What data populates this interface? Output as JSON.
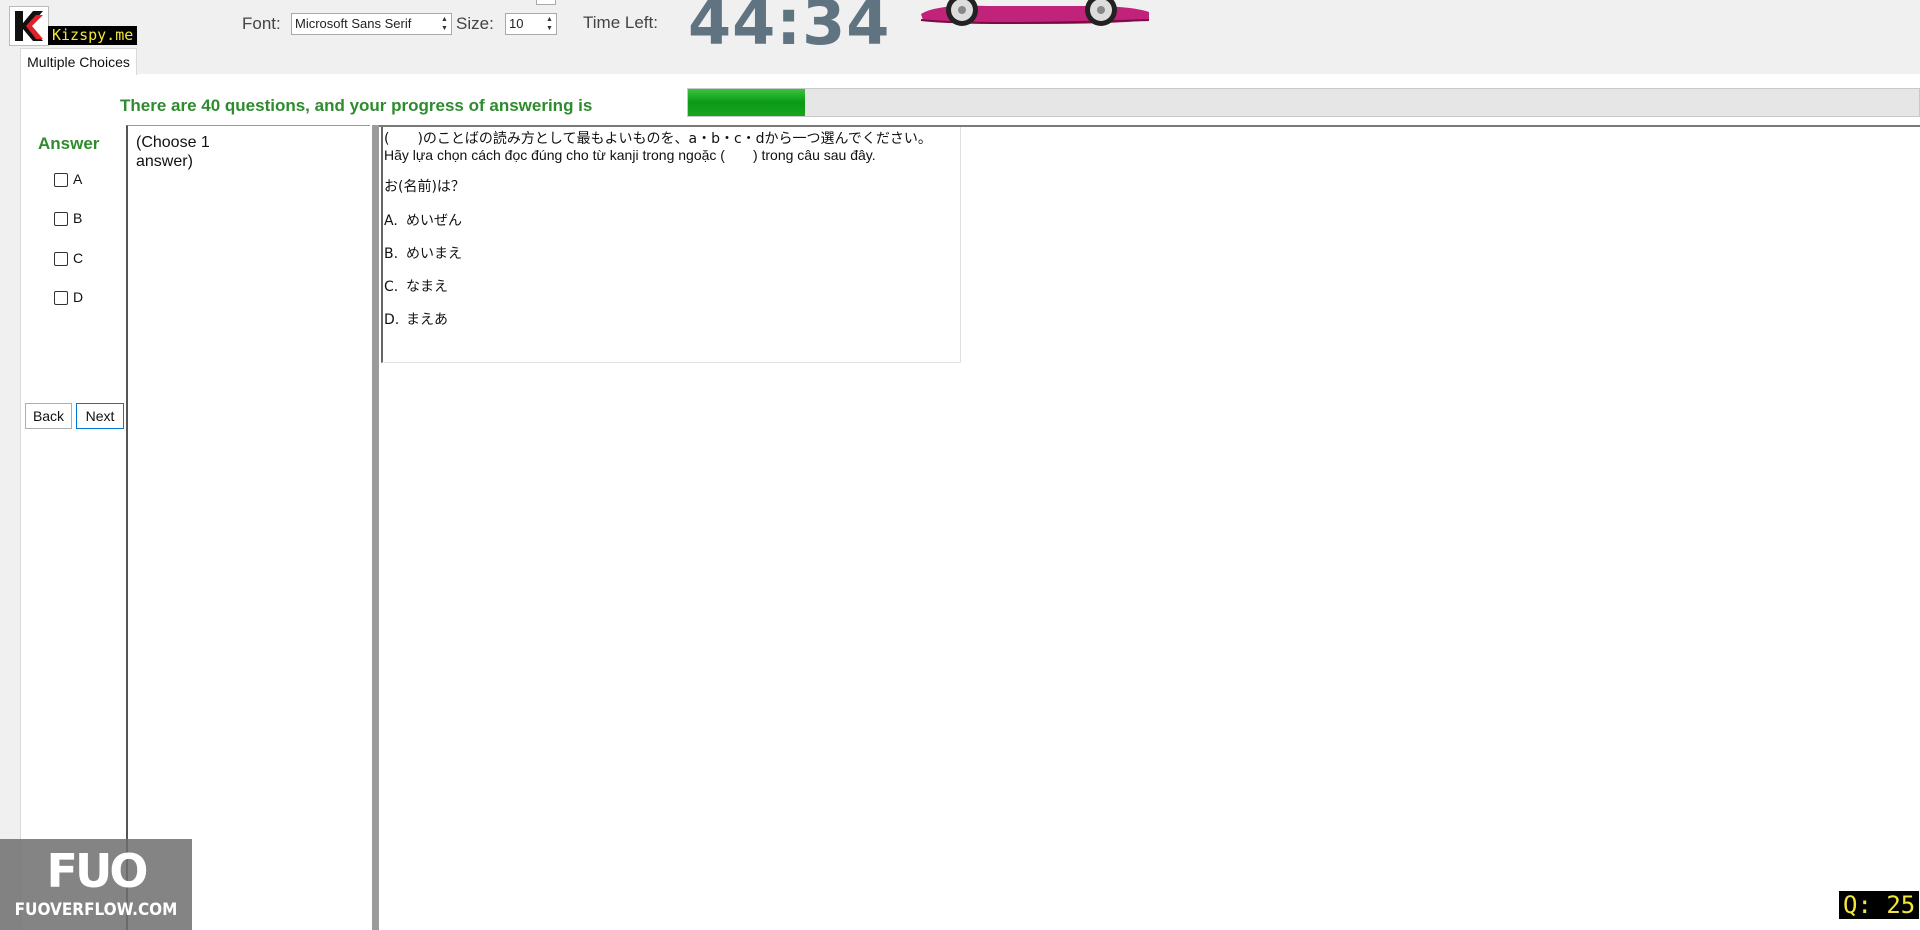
{
  "header": {
    "brand": "Kizspy.me",
    "font_label": "Font:",
    "font_value": "Microsoft Sans Serif",
    "size_label": "Size:",
    "size_value": "10",
    "time_left_label": "Time Left:",
    "timer": "44:34"
  },
  "tabs": [
    {
      "label": "Multiple Choices"
    }
  ],
  "progress": {
    "text": "There are 40 questions, and your progress of answering is",
    "fraction": 0.095,
    "color": "#0a9a16"
  },
  "answer": {
    "title": "Answer",
    "options": [
      "A",
      "B",
      "C",
      "D"
    ]
  },
  "nav": {
    "back": "Back",
    "next": "Next"
  },
  "choose_text": "(Choose 1 answer)",
  "question": {
    "instruction_ja": "(　　)のことばの読み方として最もよいものを、a・b・c・dから一つ選んでください。",
    "instruction_vi": "Hãy lựa chọn cách đọc đúng cho từ kanji trong ngoặc (　　) trong câu sau đây.",
    "prompt": "お(名前)は？",
    "choices": [
      {
        "mark": "A.",
        "text": "めいぜん"
      },
      {
        "mark": "B.",
        "text": "めいまえ"
      },
      {
        "mark": "C.",
        "text": "なまえ"
      },
      {
        "mark": "D.",
        "text": "まえあ"
      }
    ]
  },
  "watermark": {
    "logo": "FUO",
    "text": "FUOVERFLOW.COM"
  },
  "question_counter": "Q: 25",
  "colors": {
    "accent_green": "#2e8b2e",
    "timer": "#5f7381",
    "badge_bg": "#000000",
    "badge_fg": "#f3e63a"
  }
}
